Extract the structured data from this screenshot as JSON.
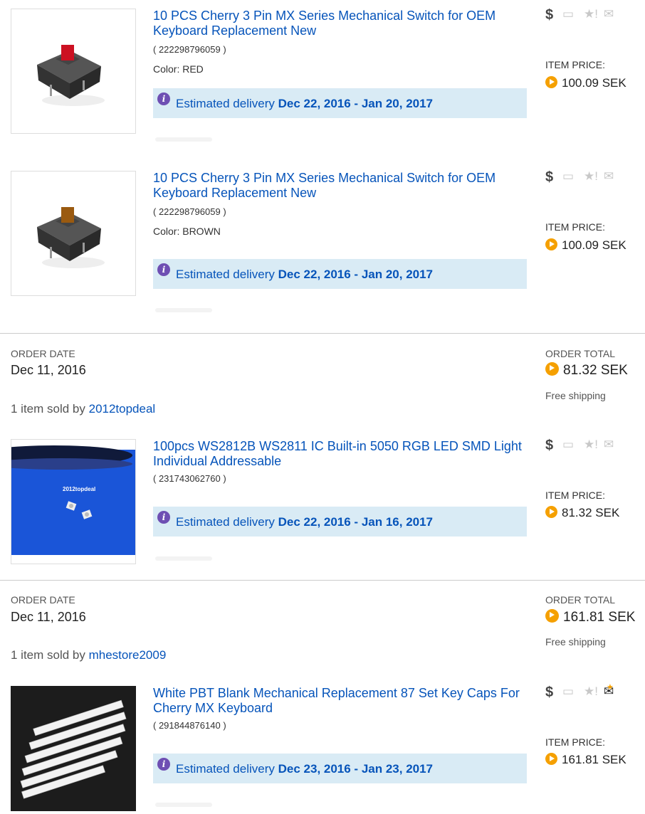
{
  "items": [
    {
      "title": "10 PCS Cherry 3 Pin MX Series Mechanical Switch for OEM Keyboard Replacement New",
      "item_id": "( 222298796059 )",
      "variation": "Color: RED",
      "delivery_prefix": "Estimated delivery ",
      "delivery_range": "Dec 22, 2016 - Jan 20, 2017",
      "price_label": "ITEM PRICE:",
      "price": "100.09 SEK",
      "stem_color": "#cc1122"
    },
    {
      "title": "10 PCS Cherry 3 Pin MX Series Mechanical Switch for OEM Keyboard Replacement New",
      "item_id": "( 222298796059 )",
      "variation": "Color: BROWN",
      "delivery_prefix": "Estimated delivery ",
      "delivery_range": "Dec 22, 2016 - Jan 20, 2017",
      "price_label": "ITEM PRICE:",
      "price": "100.09 SEK",
      "stem_color": "#9a5a10"
    },
    {
      "title": "100pcs WS2812B WS2811 IC Built-in 5050 RGB LED SMD Light Individual Addressable",
      "item_id": "( 231743062760 )",
      "delivery_prefix": "Estimated delivery ",
      "delivery_range": "Dec 22, 2016 - Jan 16, 2017",
      "price_label": "ITEM PRICE:",
      "price": "81.32 SEK",
      "image_watermark": "2012topdeal"
    },
    {
      "title": "White PBT Blank Mechanical Replacement 87 Set Key Caps For Cherry MX Keyboard",
      "item_id": "( 291844876140 )",
      "delivery_prefix": "Estimated delivery ",
      "delivery_range": "Dec 23, 2016 - Jan 23, 2017",
      "price_label": "ITEM PRICE:",
      "price": "161.81 SEK"
    }
  ],
  "orders": [
    {
      "date_label": "ORDER DATE",
      "date": "Dec 11, 2016",
      "total_label": "ORDER TOTAL",
      "total": "81.32 SEK",
      "shipping": "Free shipping",
      "sold_prefix": "1 item sold by ",
      "seller": "2012topdeal"
    },
    {
      "date_label": "ORDER DATE",
      "date": "Dec 11, 2016",
      "total_label": "ORDER TOTAL",
      "total": "161.81 SEK",
      "shipping": "Free shipping",
      "sold_prefix": "1 item sold by ",
      "seller": "mhestore2009"
    }
  ],
  "icons": {
    "paid": "dollar-icon",
    "shipped": "shipped-box-icon",
    "feedback": "feedback-star-icon",
    "message": "message-envelope-icon"
  },
  "colors": {
    "link": "#0654ba",
    "delivery_bg": "#d9ebf5",
    "info_icon": "#6e4fb3",
    "coin": "#f5a000"
  }
}
